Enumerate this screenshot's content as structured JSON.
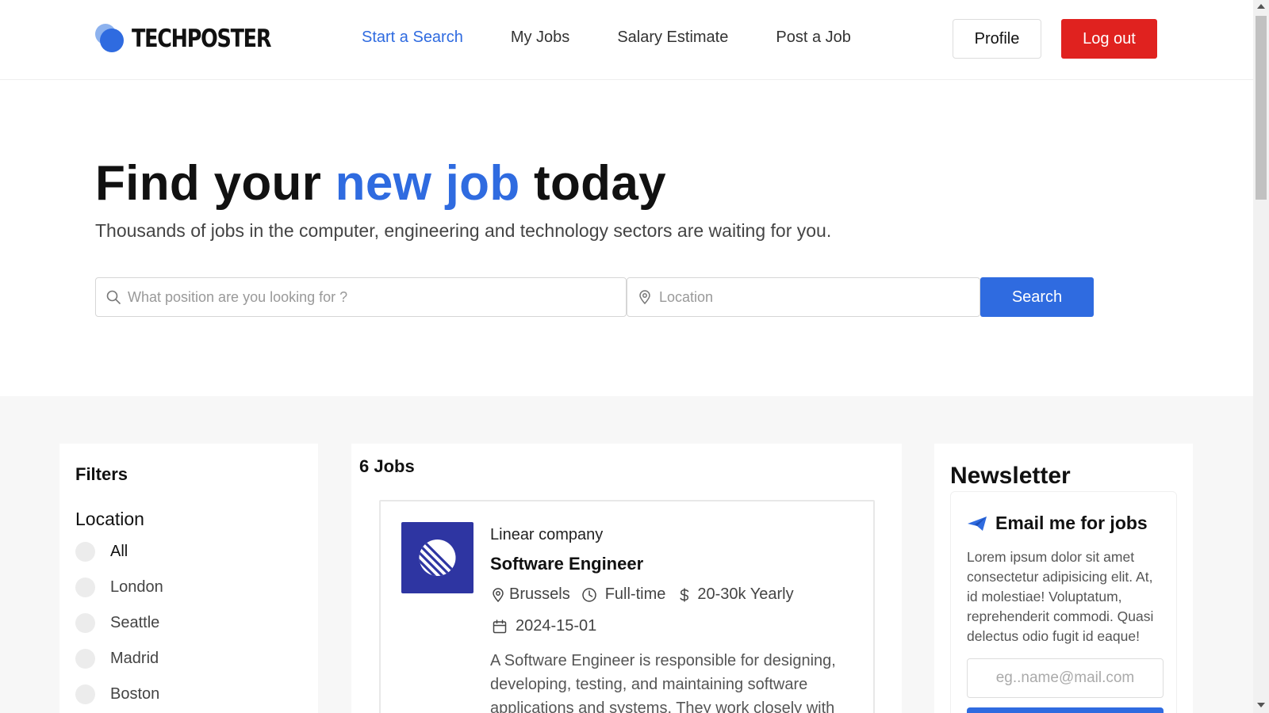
{
  "brand": {
    "name": "TECHPOSTER",
    "accent": "#2f6be0",
    "logout_color": "#e0221f"
  },
  "nav": [
    {
      "label": "Start a Search",
      "active": true
    },
    {
      "label": "My Jobs",
      "active": false
    },
    {
      "label": "Salary Estimate",
      "active": false
    },
    {
      "label": "Post a Job",
      "active": false
    }
  ],
  "header": {
    "profile_label": "Profile",
    "logout_label": "Log out"
  },
  "hero": {
    "title_part1": "Find your ",
    "title_accent": "new job",
    "title_part2": " today",
    "subtitle": "Thousands of jobs in the computer, engineering and technology sectors are waiting for you."
  },
  "search": {
    "position_placeholder": "What position are you looking for ?",
    "position_icon": "search-icon",
    "location_placeholder": "Location",
    "location_icon": "map-pin-icon",
    "button_label": "Search"
  },
  "filters": {
    "title": "Filters",
    "location_label": "Location",
    "options": [
      "All",
      "London",
      "Seattle",
      "Madrid",
      "Boston"
    ],
    "selected": "All"
  },
  "jobs": {
    "count_label": "6 Jobs",
    "items": [
      {
        "company": "Linear company",
        "title": "Software Engineer",
        "location": "Brussels",
        "type": "Full-time",
        "salary": "20-30k Yearly",
        "date": "2024-15-01",
        "description": "A Software Engineer is responsible for designing, developing, testing, and maintaining software applications and systems. They work closely with"
      }
    ]
  },
  "newsletter": {
    "title": "Newsletter",
    "card_title": "Email me for jobs",
    "text": "Lorem ipsum dolor sit amet consectetur adipisicing elit. At, id molestiae! Voluptatum, reprehenderit commodi. Quasi delectus odio fugit id eaque!",
    "email_placeholder": "eg..name@mail.com"
  }
}
